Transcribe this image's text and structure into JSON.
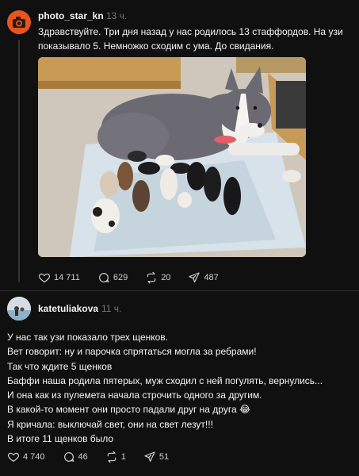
{
  "posts": [
    {
      "username": "photo_star_kn",
      "time": "13 ч.",
      "text_lines": [
        "Здравствуйте. Три дня назад у нас родилось 13 стаффордов. На узи",
        "показывало 5. Немножко сходим с ума. До свидания."
      ],
      "stats": {
        "likes": "14 711",
        "comments": "629",
        "reposts": "20",
        "shares": "487"
      }
    },
    {
      "username": "katetuliakova",
      "time": "11 ч.",
      "text_lines": [
        "У нас так узи показало трех щенков.",
        "Вет говорит: ну и парочка спрятаться могла за ребрами!",
        "Так что ждите 5 щенков",
        "Баффи наша родила пятерых, муж сходил с ней погулять, вернулись...",
        "И она как из пулемета начала строчить одного за другим.",
        "В какой-то момент они просто падали друг на друга 😂",
        "Я кричала: выключай свет, они на свет лезут!!!",
        "В итоге 11 щенков было"
      ],
      "stats": {
        "likes": "4 740",
        "comments": "46",
        "reposts": "1",
        "shares": "51"
      }
    }
  ],
  "icons": {
    "like": "heart-icon",
    "comment": "comment-icon",
    "repost": "repost-icon",
    "share": "share-icon"
  },
  "colors": {
    "background": "#101010",
    "text": "#f3f5f7",
    "muted": "#777777",
    "avatar1": "#e8541e"
  }
}
